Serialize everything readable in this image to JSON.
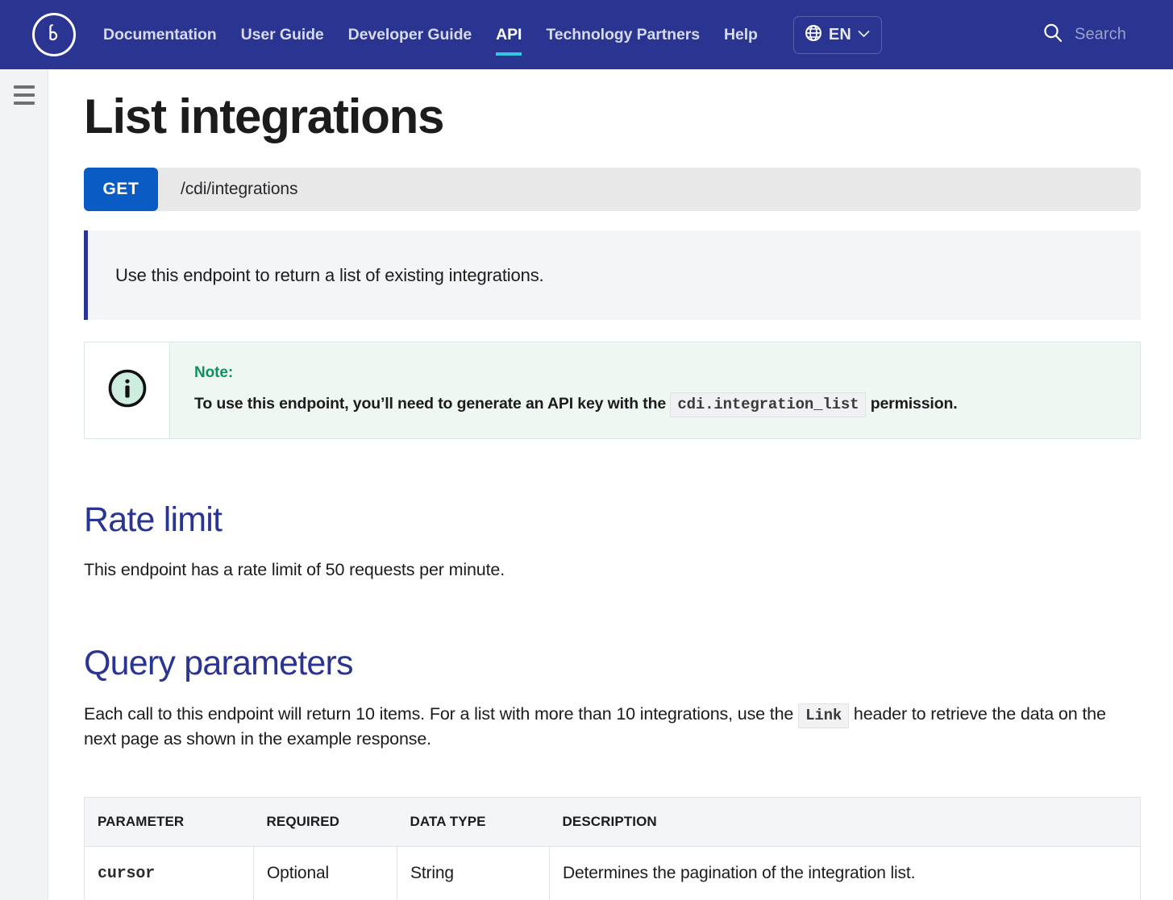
{
  "nav": {
    "logo_icon": "bazaarvoice-b-logo-icon",
    "links": [
      {
        "label": "Documentation",
        "active": false
      },
      {
        "label": "User Guide",
        "active": false
      },
      {
        "label": "Developer Guide",
        "active": false
      },
      {
        "label": "API",
        "active": true
      },
      {
        "label": "Technology Partners",
        "active": false
      },
      {
        "label": "Help",
        "active": false
      }
    ],
    "language": {
      "code": "EN",
      "globe_icon": "globe-icon",
      "chevron_icon": "chevron-down-icon"
    },
    "search": {
      "icon": "search-icon",
      "placeholder": "Search"
    },
    "background_color": "#2a3491",
    "active_underline_color": "#35c6e0"
  },
  "sidebar": {
    "menu_icon": "hamburger-menu-icon"
  },
  "main": {
    "title": "List integrations",
    "endpoint": {
      "method": "GET",
      "method_color": "#0a5bc4",
      "path": "/cdi/integrations"
    },
    "description": "Use this endpoint to return a list of existing integrations.",
    "note": {
      "icon": "info-circle-icon",
      "label": "Note:",
      "label_color": "#0f9061",
      "text_before": "To use this endpoint, you’ll need to generate an API key with the",
      "code": "cdi.integration_list",
      "text_after": "permission."
    },
    "rate_limit": {
      "heading": "Rate limit",
      "paragraph": "This endpoint has a rate limit of 50 requests per minute."
    },
    "query_parameters": {
      "heading": "Query parameters",
      "paragraph_part1": "Each call to this endpoint will return 10 items. For a list with more than 10 integrations, use the",
      "paragraph_code": "Link",
      "paragraph_part2": "header to retrieve the data on the next page as shown in the example response.",
      "table": {
        "headers": [
          "PARAMETER",
          "REQUIRED",
          "DATA TYPE",
          "DESCRIPTION"
        ],
        "rows": [
          {
            "parameter": "cursor",
            "required": "Optional",
            "data_type": "String",
            "description": "Determines the pagination of the integration list."
          }
        ]
      }
    },
    "heading_color": "#2a3491"
  }
}
